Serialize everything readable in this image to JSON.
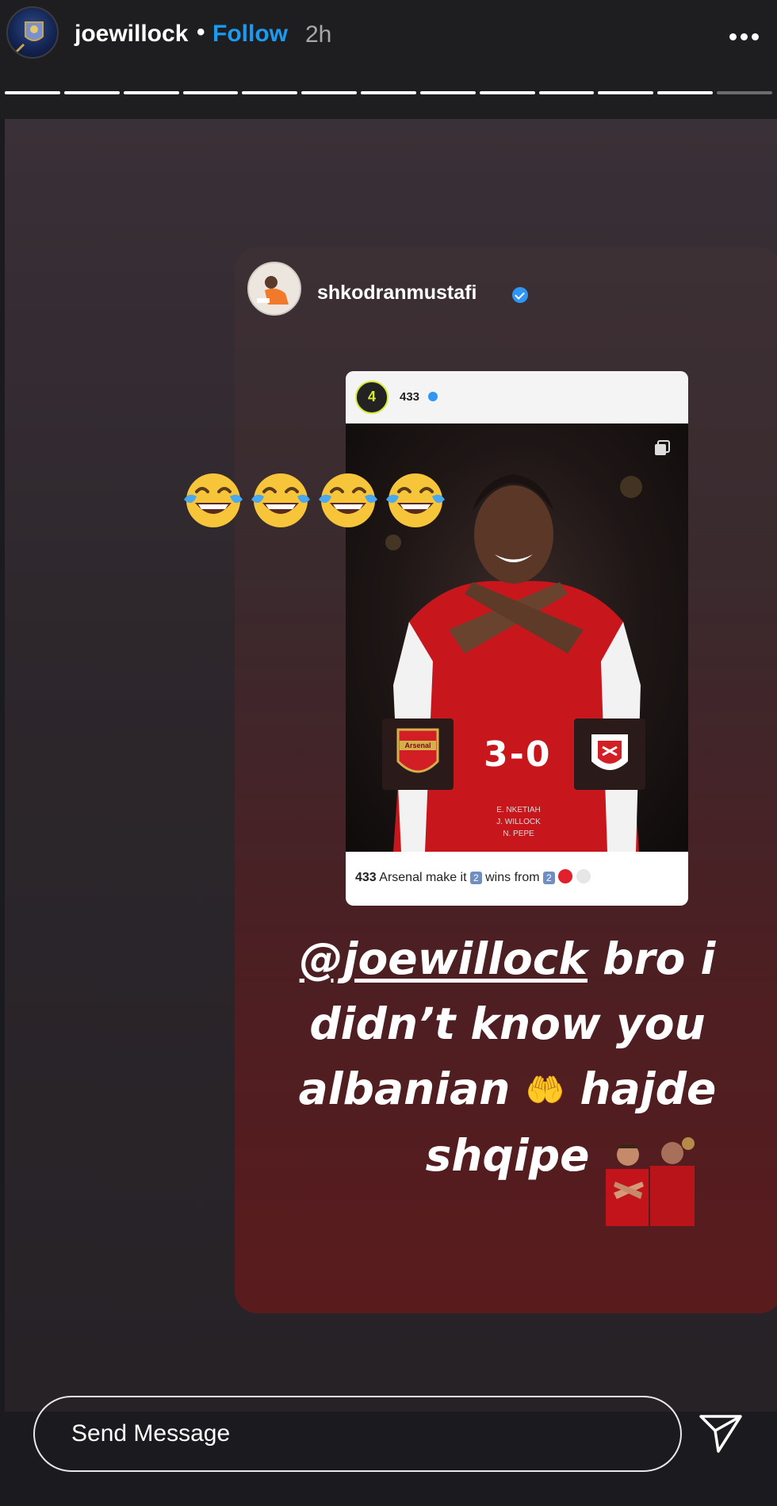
{
  "header": {
    "username": "joewillock",
    "separator": "•",
    "follow_label": "Follow",
    "time": "2h",
    "progress_segments": 13,
    "progress_done": 12
  },
  "repost": {
    "username": "shkodranmustafi",
    "post": {
      "username": "433",
      "avatar_text": "4",
      "score": "3-0",
      "scorers": [
        "E. NKETIAH",
        "J. WILLOCK",
        "N. PEPE"
      ],
      "caption_user": "433",
      "caption_text1": "Arsenal make it",
      "caption_badge1": "2",
      "caption_text2": "wins from",
      "caption_badge2": "2",
      "crest_left_text": "Arsenal"
    },
    "caption": {
      "mention": "@joewillock",
      "text_line1": " bro i",
      "text_line2": "didn’t know you",
      "text_line3a": "albanian ",
      "text_line3b": " hajde",
      "text_line4": "shqipe",
      "hands_emoji": "🤲"
    }
  },
  "footer": {
    "message_placeholder": "Send Message"
  },
  "colors": {
    "follow": "#1a9bf0",
    "verified": "#2f96f3"
  }
}
